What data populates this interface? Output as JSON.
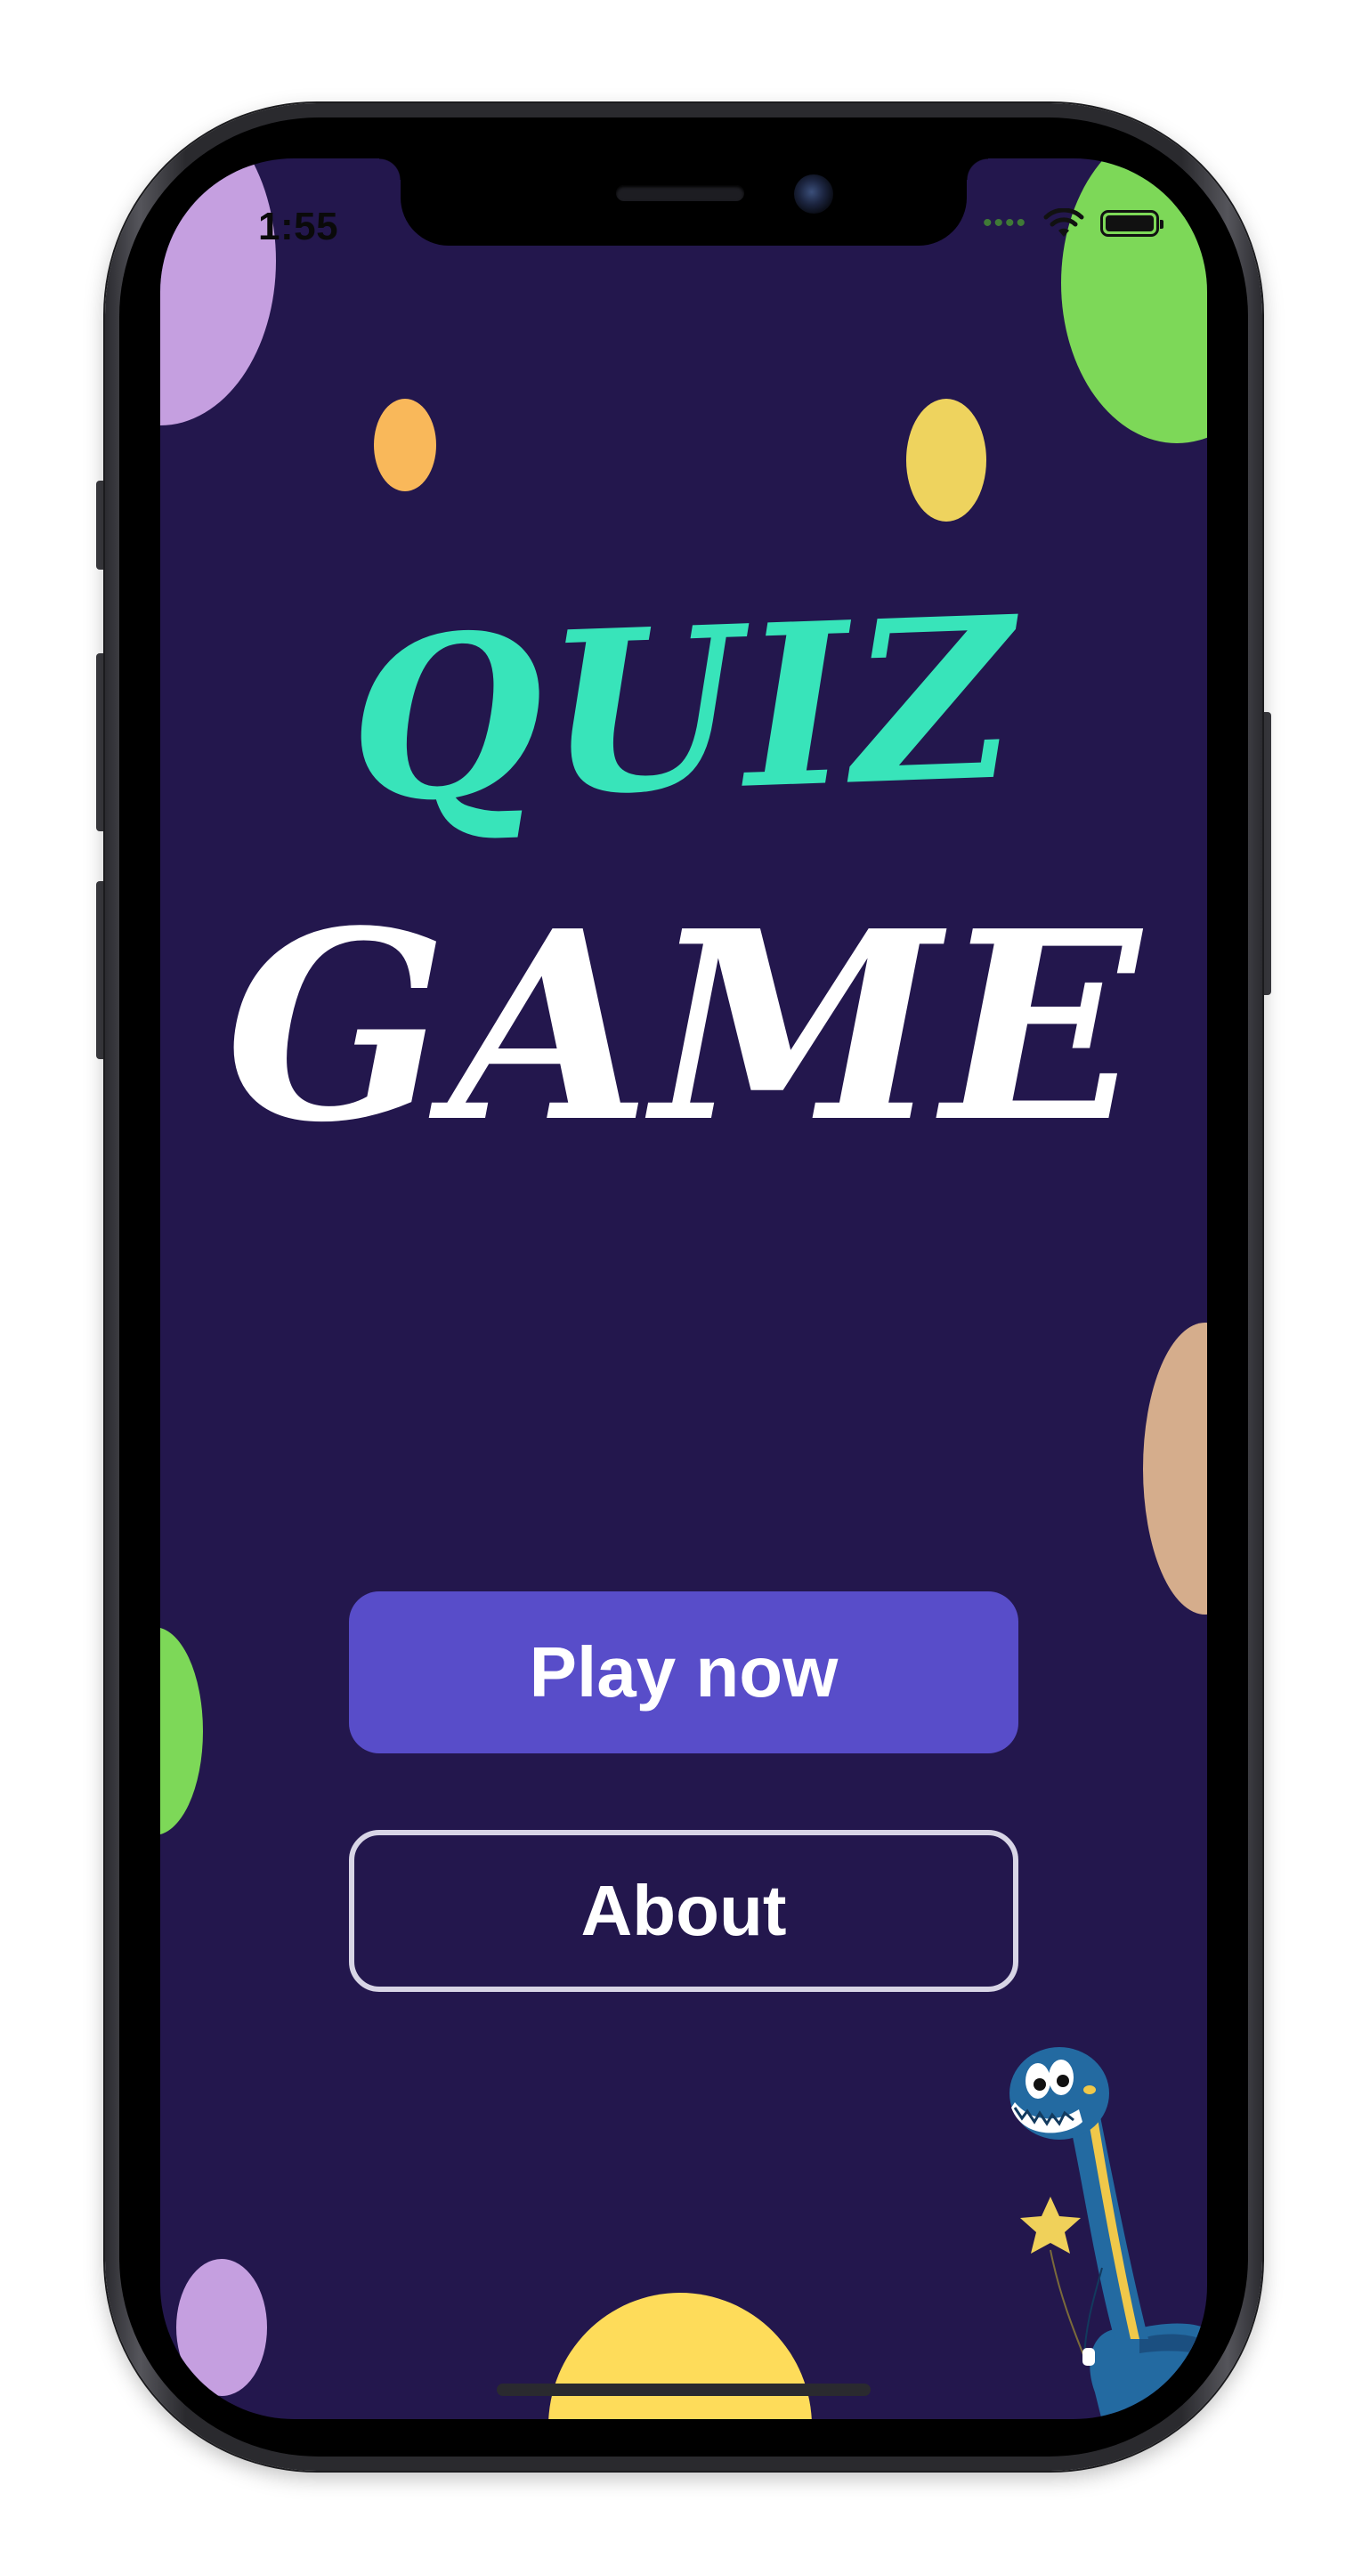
{
  "status_bar": {
    "time": "1:55",
    "signal": "••••",
    "wifi_icon": "wifi-icon",
    "battery_icon": "battery-full-icon"
  },
  "title": {
    "line1": "QUIZ",
    "line2": "GAME"
  },
  "buttons": {
    "play": "Play now",
    "about": "About"
  },
  "colors": {
    "background": "#23174d",
    "title_accent": "#38e4ba",
    "play_button": "#584dc9",
    "about_border": "#d8d5e6"
  },
  "illustration": "dinosaur-mascot"
}
